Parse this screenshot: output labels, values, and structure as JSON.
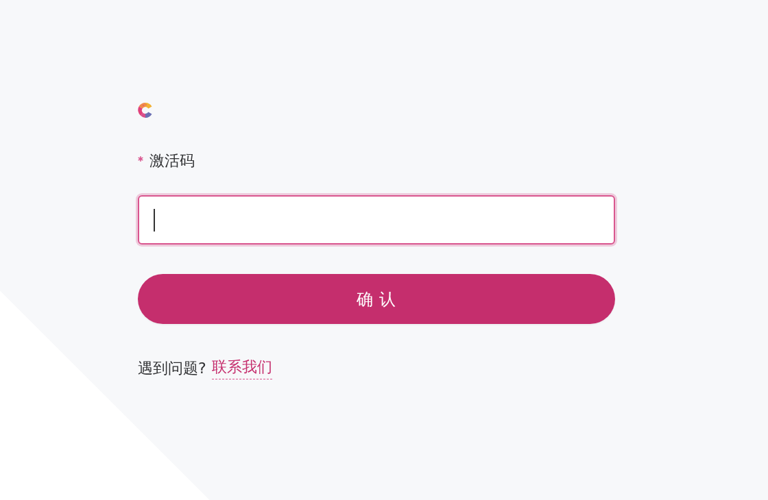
{
  "form": {
    "field": {
      "label": "激活码",
      "required": true,
      "focused": true
    },
    "submit": {
      "label": "确 认"
    },
    "help": {
      "text": "遇到问题?",
      "link": "联系我们"
    }
  }
}
